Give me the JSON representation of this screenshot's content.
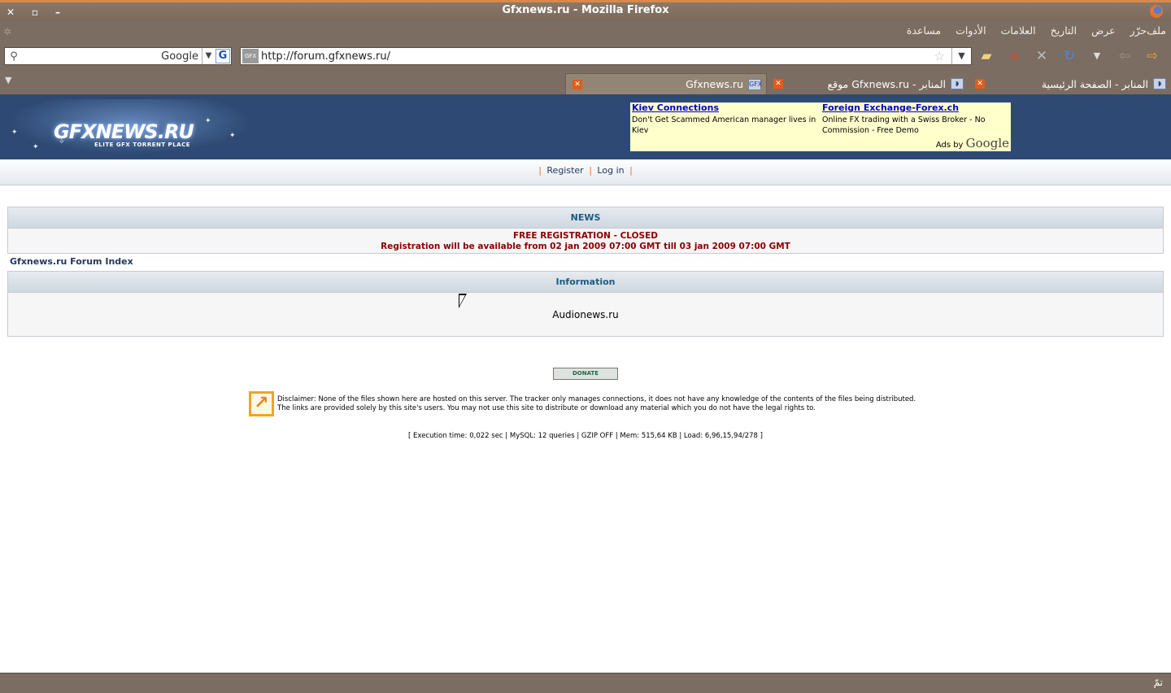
{
  "window": {
    "title": "Gfxnews.ru - Mozilla Firefox",
    "close_label": "✕",
    "maximize_label": "▫",
    "minimize_label": "–"
  },
  "menu": [
    "ملف",
    "حرّر",
    "عرض",
    "التاريخ",
    "العلامات",
    "الأدوات",
    "مساعدة"
  ],
  "search": {
    "engine": "Google",
    "value": ""
  },
  "address": {
    "url": "http://forum.gfxnews.ru/",
    "favicon": "GFX"
  },
  "tabs": [
    {
      "label": "المنابر - الصفحة الرئيسية",
      "active": false
    },
    {
      "label": "موقع Gfxnews.ru - المنابر",
      "active": false
    },
    {
      "label": "Gfxnews.ru",
      "active": true
    }
  ],
  "header": {
    "logo_title": "GFXNEWS.RU",
    "logo_subtitle": "ELITE GFX TORRENT PLACE"
  },
  "ads": [
    {
      "title": "Kiev Connections",
      "text": "Don't Get Scammed American manager lives in Kiev"
    },
    {
      "title": "Foreign Exchange-Forex.ch",
      "text": "Online FX trading with a Swiss Broker - No Commission - Free Demo"
    }
  ],
  "ads_by": {
    "prefix": "Ads by",
    "brand": "Google"
  },
  "nav_links": {
    "register": "Register",
    "login": "Log in"
  },
  "news": {
    "heading": "NEWS",
    "line1": "FREE REGISTRATION - CLOSED",
    "line2": "Registration will be available from 02 jan 2009 07:00 GMT till 03 jan 2009 07:00 GMT"
  },
  "forum_index": "Gfxnews.ru Forum Index",
  "information": {
    "heading": "Information",
    "text": "Audionews.ru"
  },
  "donate_label": "DONATE",
  "disclaimer": {
    "line1": "Disclaimer: None of the files shown here are hosted on this server. The tracker only manages connections, it does not have any knowledge of the contents of the files being distributed.",
    "line2": "The links are provided solely by this site's users. You may not use this site to distribute or download any material which you do not have the legal rights to."
  },
  "exec_stats": "[ Execution time: 0,022 sec  |  MySQL: 12 queries  |  GZIP OFF  |  Mem: 515,64 KB  |  Load: 6,96,15,94/278 ]",
  "status": "تمّ",
  "colors": {
    "chrome": "#7b6d61",
    "header": "#2e4a74",
    "news_text": "#8a0000",
    "link": "#23395a",
    "accent": "#e1762c"
  }
}
